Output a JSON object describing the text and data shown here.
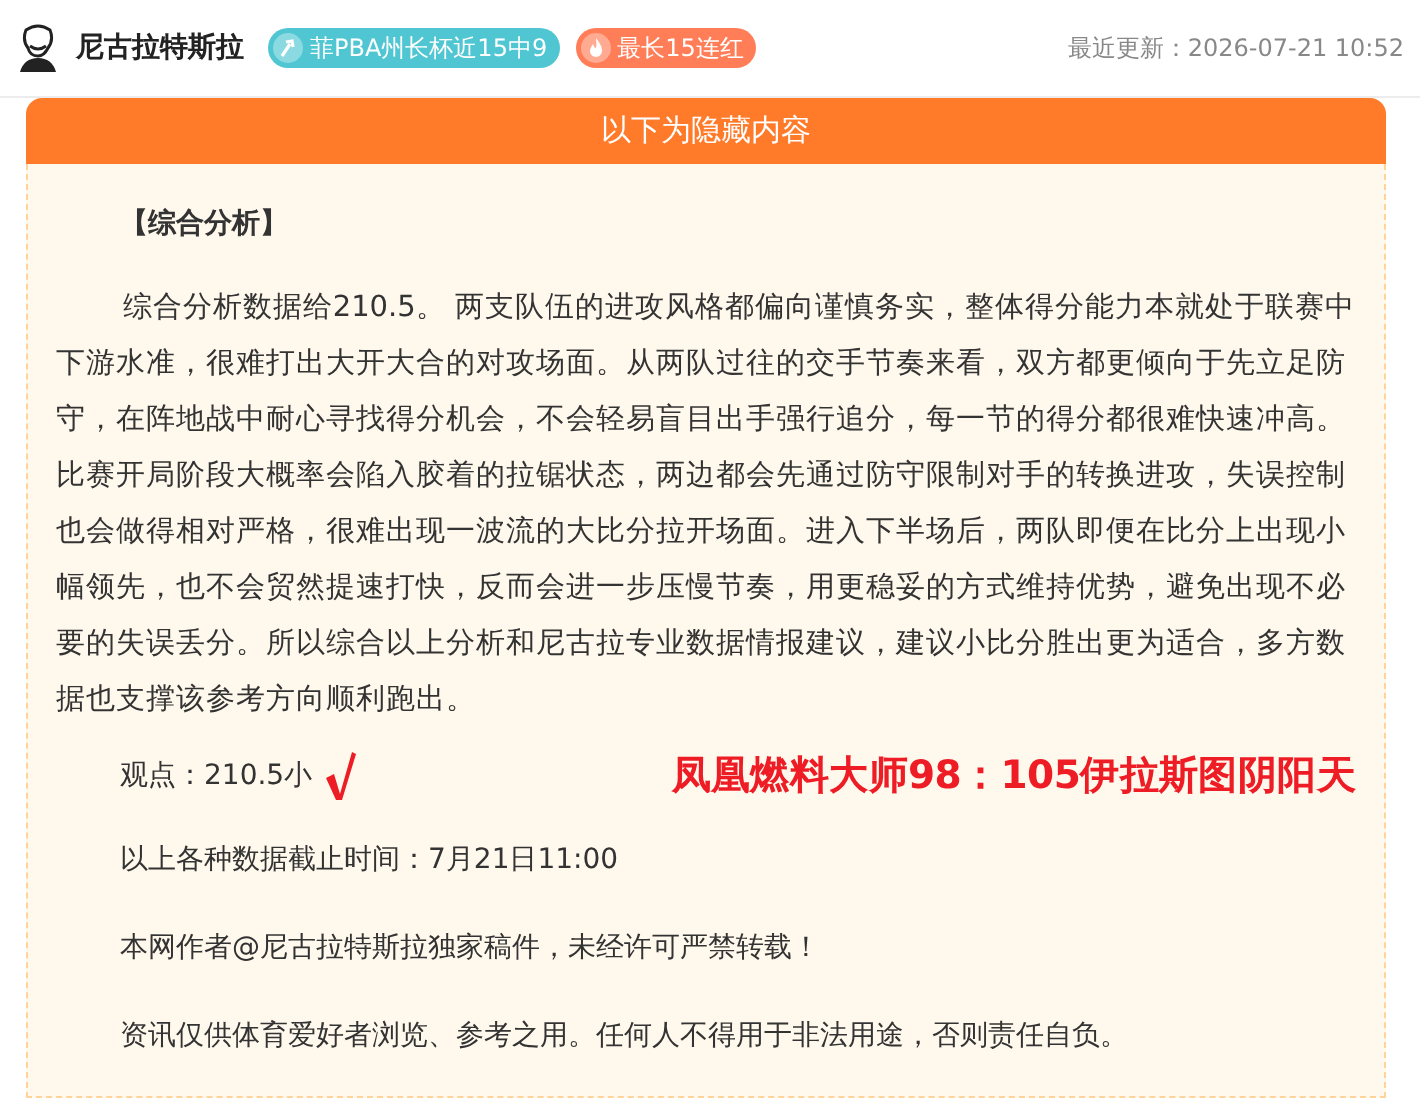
{
  "header": {
    "author": "尼古拉特斯拉",
    "badges": [
      {
        "kind": "trend",
        "text": "菲PBA州长杯近15中9",
        "color": "#4fc6d2"
      },
      {
        "kind": "fire",
        "text": "最长15连红",
        "color": "#ff7d57"
      }
    ],
    "updated": "最近更新：2026-07-21 10:52"
  },
  "card": {
    "title": "以下为隐藏内容",
    "heading": "【综合分析】",
    "paragraph": "综合分析数据给210.5。 两支队伍的进攻风格都偏向谨慎务实，整体得分能力本就处于联赛中下游水准，很难打出大开大合的对攻场面。从两队过往的交手节奏来看，双方都更倾向于先立足防守，在阵地战中耐心寻找得分机会，不会轻易盲目出手强行追分，每一节的得分都很难快速冲高。比赛开局阶段大概率会陷入胶着的拉锯状态，两边都会先通过防守限制对手的转换进攻，失误控制也会做得相对严格，很难出现一波流的大比分拉开场面。进入下半场后，两队即便在比分上出现小幅领先，也不会贸然提速打快，反而会进一步压慢节奏，用更稳妥的方式维持优势，避免出现不必要的失误丢分。所以综合以上分析和尼古拉专业数据情报建议，建议小比分胜出更为适合，多方数据也支撑该参考方向顺利跑出。",
    "verdict": {
      "text": "观点：210.5小",
      "hit": true
    },
    "promo": "凤凰燃料大师98：105伊拉斯图阴阳天",
    "notes": [
      "以上各种数据截止时间：7月21日11:00",
      "本网作者@尼古拉特斯拉独家稿件，未经许可严禁转载！",
      "资讯仅供体育爱好者浏览、参考之用。任何人不得用于非法用途，否则责任自负。"
    ]
  }
}
